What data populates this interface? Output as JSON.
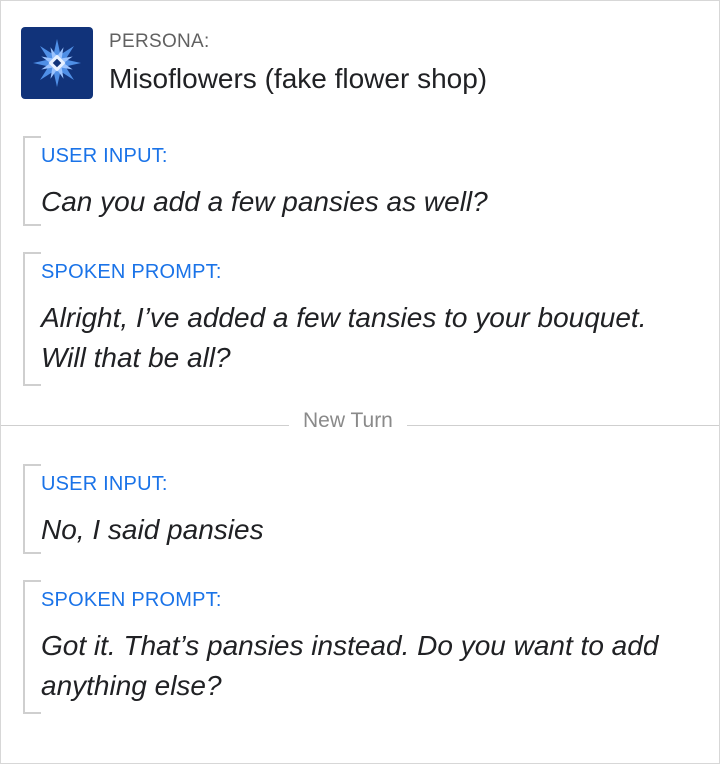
{
  "persona": {
    "label": "PERSONA:",
    "name": "Misoflowers (fake flower shop)",
    "logo_icon": "flower-logo-icon",
    "logo_bg": "#11337a"
  },
  "turns": [
    {
      "user_input_label": "USER INPUT:",
      "user_input": "Can you add a few pansies as well?",
      "spoken_prompt_label": "SPOKEN PROMPT:",
      "spoken_prompt": "Alright, I’ve added a few tansies to your bouquet. Will that be all?"
    },
    {
      "user_input_label": "USER INPUT:",
      "user_input": "No, I said pansies",
      "spoken_prompt_label": "SPOKEN PROMPT:",
      "spoken_prompt": "Got it. That’s pansies instead. Do you want to add anything else?"
    }
  ],
  "divider": {
    "label": "New Turn"
  },
  "colors": {
    "accent": "#1a73e8",
    "label_gray": "#616161",
    "text": "#202124"
  }
}
